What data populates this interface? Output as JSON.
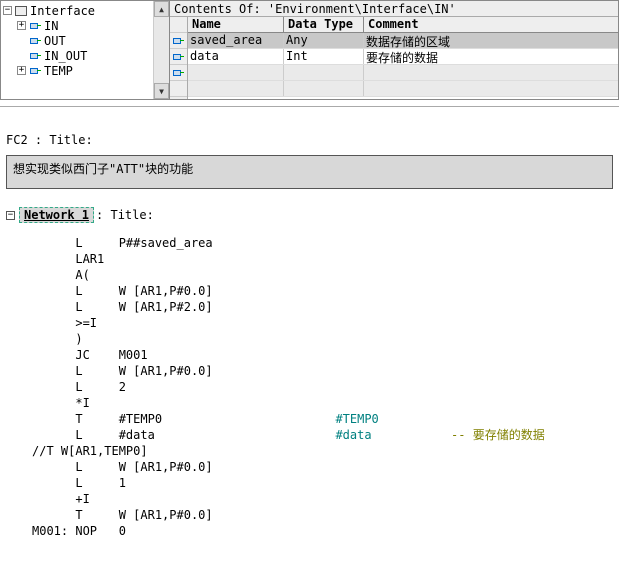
{
  "tree": {
    "root_label": "Interface",
    "root_expander": "−",
    "items": [
      {
        "expander": "+",
        "label": "IN"
      },
      {
        "expander": "",
        "label": "OUT"
      },
      {
        "expander": "",
        "label": "IN_OUT"
      },
      {
        "expander": "+",
        "label": "TEMP"
      }
    ]
  },
  "path_bar": "Contents Of: 'Environment\\Interface\\IN'",
  "grid": {
    "headers": {
      "name": "Name",
      "type": "Data Type",
      "comment": "Comment"
    },
    "rows": [
      {
        "name": "saved_area",
        "type": "Any",
        "comment": "数据存储的区域",
        "selected": true
      },
      {
        "name": "data",
        "type": "Int",
        "comment": "要存储的数据",
        "selected": false
      }
    ]
  },
  "fc_header": "FC2 : Title:",
  "title_box": "想实现类似西门子\"ATT\"块的功能",
  "network": {
    "expander": "−",
    "label": "Network 1",
    "suffix": ": Title:"
  },
  "code_lines": [
    {
      "op": "L",
      "arg": "P##saved_area"
    },
    {
      "op": "LAR1",
      "arg": ""
    },
    {
      "op": "A(",
      "arg": ""
    },
    {
      "op": "L",
      "arg": "W [AR1,P#0.0]"
    },
    {
      "op": "L",
      "arg": "W [AR1,P#2.0]"
    },
    {
      "op": ">=I",
      "arg": ""
    },
    {
      "op": ")",
      "arg": ""
    },
    {
      "op": "JC",
      "arg": "M001"
    },
    {
      "op": "L",
      "arg": "W [AR1,P#0.0]"
    },
    {
      "op": "L",
      "arg": "2"
    },
    {
      "op": "*I",
      "arg": ""
    },
    {
      "op": "T",
      "arg": "#TEMP0",
      "sym": "#TEMP0"
    },
    {
      "op": "L",
      "arg": "#data",
      "sym": "#data",
      "cmt": "-- 要存储的数据"
    },
    {
      "raw": "//T W[AR1,TEMP0]"
    },
    {
      "op": "L",
      "arg": "W [AR1,P#0.0]"
    },
    {
      "op": "L",
      "arg": "1"
    },
    {
      "op": "+I",
      "arg": ""
    },
    {
      "op": "T",
      "arg": "W [AR1,P#0.0]"
    },
    {
      "label": "M001:",
      "op": "NOP",
      "arg": "0"
    }
  ]
}
